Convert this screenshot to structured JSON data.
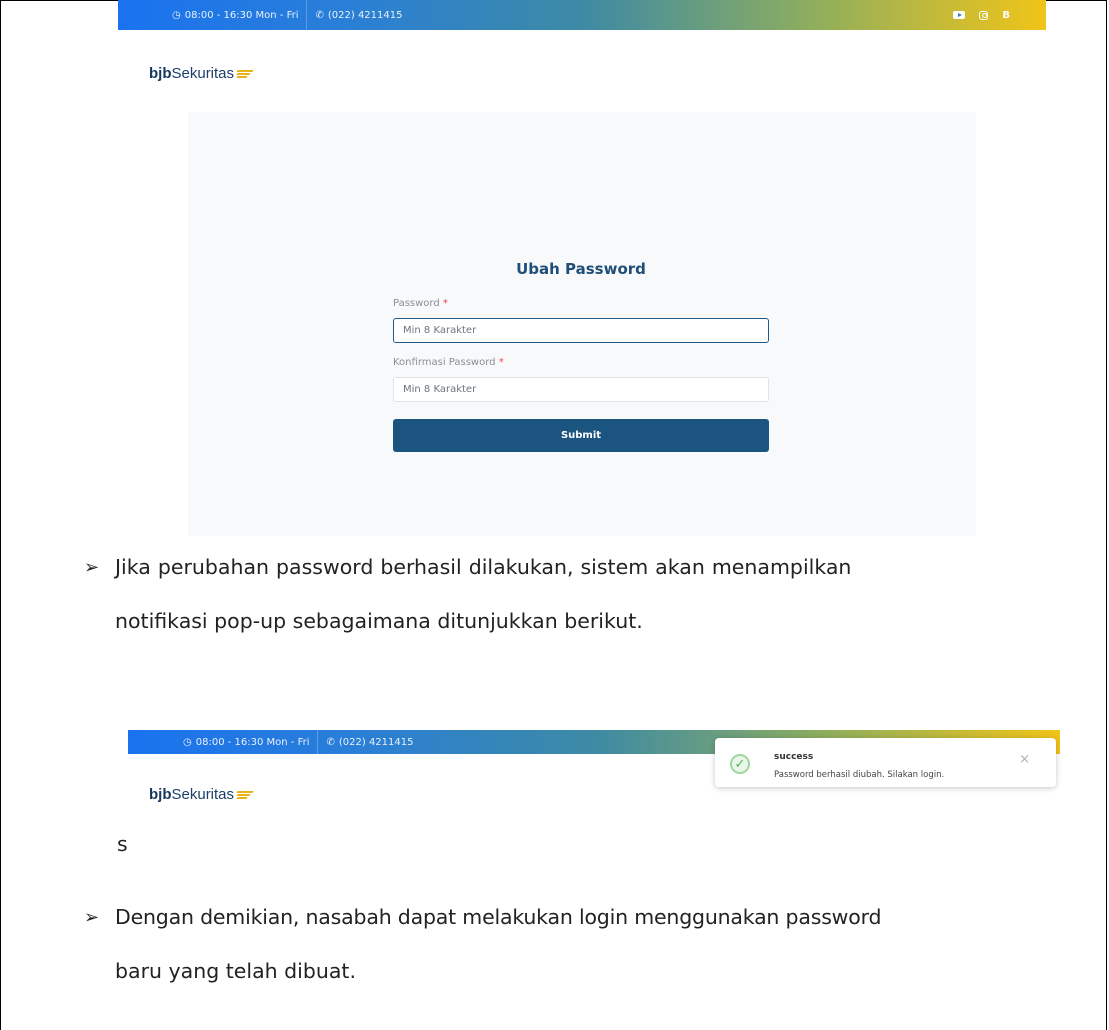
{
  "top_screenshot": {
    "hours": "08:00 - 16:30 Mon - Fri",
    "phone": "(022) 4211415",
    "social_b": "B",
    "logo_bold": "bjb",
    "logo_regular": "Sekuritas",
    "form": {
      "title": "Ubah Password",
      "password_label": "Password",
      "password_placeholder": "Min 8 Karakter",
      "confirm_label": "Konfirmasi Password",
      "confirm_placeholder": "Min 8 Karakter",
      "required_mark": "*",
      "submit_label": "Submit"
    }
  },
  "paragraph1": {
    "line1": "Jika perubahan password berhasil dilakukan, sistem akan menampilkan",
    "line2": "notifikasi pop-up sebagaimana ditunjukkan berikut."
  },
  "bottom_screenshot": {
    "hours": "08:00 - 16:30 Mon - Fri",
    "phone": "(022) 4211415",
    "logo_bold": "bjb",
    "logo_regular": "Sekuritas",
    "toast": {
      "title": "success",
      "message": "Password berhasil diubah. Silakan login.",
      "close": "×"
    }
  },
  "stray_letter": "s",
  "paragraph2": {
    "line1": "Dengan demikian, nasabah dapat melakukan login menggunakan password",
    "line2": "baru yang telah dibuat."
  },
  "bullet_glyph": "➢"
}
